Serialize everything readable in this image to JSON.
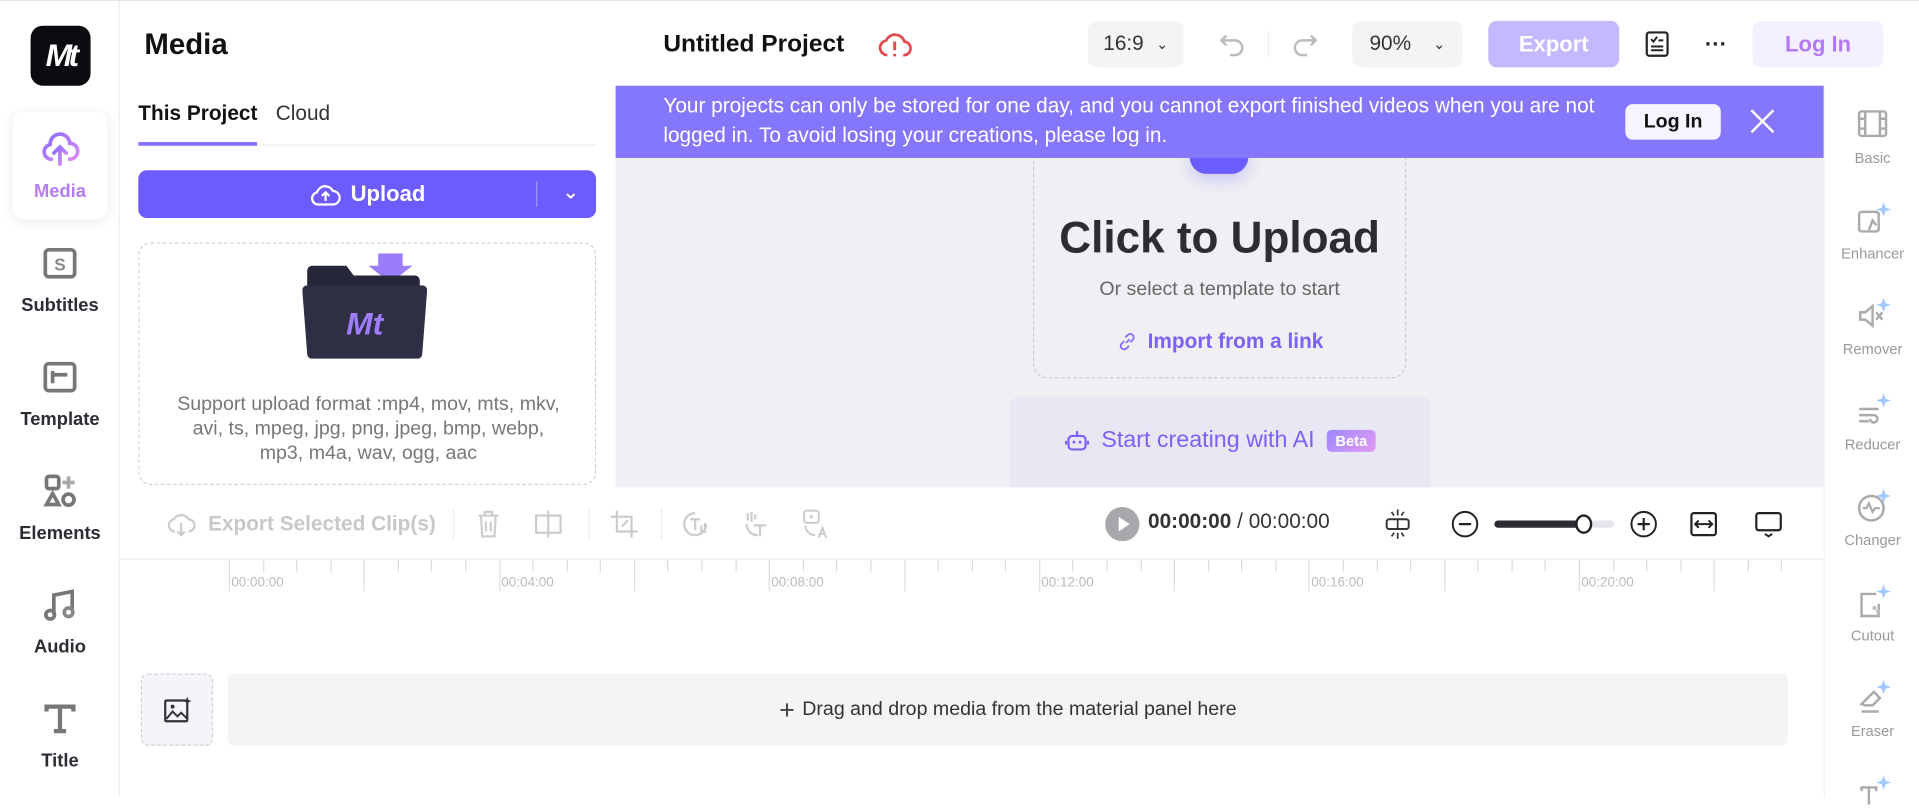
{
  "nav": {
    "logo": "Mt",
    "items": [
      {
        "label": "Media",
        "icon": "cloud-upload-icon",
        "active": true
      },
      {
        "label": "Subtitles",
        "icon": "subtitles-icon"
      },
      {
        "label": "Template",
        "icon": "template-icon"
      },
      {
        "label": "Elements",
        "icon": "elements-icon"
      },
      {
        "label": "Audio",
        "icon": "music-note-icon"
      },
      {
        "label": "Title",
        "icon": "text-icon"
      }
    ]
  },
  "panel": {
    "title": "Media",
    "tabs": [
      {
        "label": "This Project",
        "active": true
      },
      {
        "label": "Cloud"
      }
    ],
    "upload_label": "Upload",
    "formats": "Support upload format :mp4, mov, mts, mkv, avi, ts, mpeg, jpg, png, jpeg, bmp, webp, mp3, m4a, wav, ogg, aac"
  },
  "topbar": {
    "project_title": "Untitled Project",
    "aspect_ratio": "16:9",
    "zoom": "90%",
    "export_label": "Export",
    "login_label": "Log In"
  },
  "banner": {
    "message": "Your projects can only be stored for one day, and you cannot export finished videos when you are not logged in. To avoid losing your creations, please log in.",
    "login_label": "Log In"
  },
  "canvas": {
    "heading": "Click to Upload",
    "subheading": "Or select a template to start",
    "import_link": "Import from a link",
    "ai_label": "Start creating with AI",
    "beta": "Beta"
  },
  "right_tools": [
    {
      "label": "Basic",
      "icon": "film-icon"
    },
    {
      "label": "Enhancer",
      "icon": "enhancer-icon"
    },
    {
      "label": "Remover",
      "icon": "mute-icon"
    },
    {
      "label": "Reducer",
      "icon": "wind-icon"
    },
    {
      "label": "Changer",
      "icon": "voice-wave-icon"
    },
    {
      "label": "Cutout",
      "icon": "cutout-icon"
    },
    {
      "label": "Eraser",
      "icon": "eraser-icon"
    }
  ],
  "toolbar": {
    "export_clips": "Export Selected Clip(s)",
    "current_time": "00:00:00",
    "separator": "/",
    "total_time": "00:00:00",
    "zoom_slider_value": 0.74
  },
  "ruler": {
    "labels": [
      "00:00:00",
      "00:04:00",
      "00:08:00",
      "00:12:00",
      "00:16:00",
      "00:20:00"
    ]
  },
  "track": {
    "drop_text": "Drag and drop media from the material panel here"
  },
  "colors": {
    "accent": "#6c5cfd",
    "banner": "#8577fb",
    "warning": "#e5484d"
  }
}
